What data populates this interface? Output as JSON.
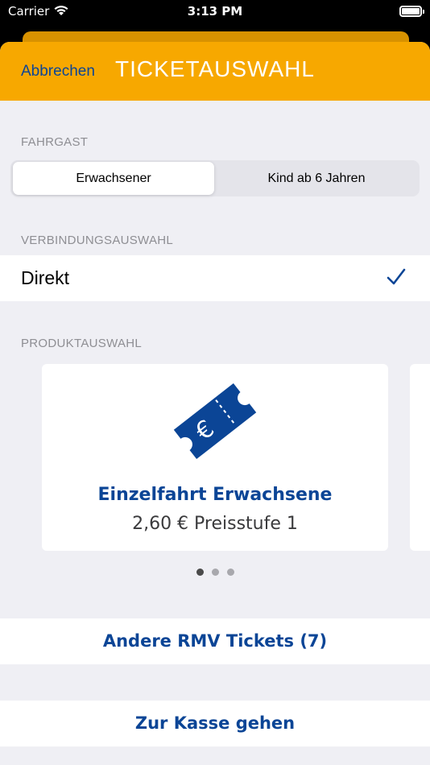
{
  "status_bar": {
    "carrier": "Carrier",
    "time": "3:13 PM"
  },
  "nav": {
    "cancel_label": "Abbrechen",
    "title": "TICKETAUSWAHL"
  },
  "fahrgast": {
    "section_label": "FAHRGAST",
    "options": [
      "Erwachsener",
      "Kind ab 6 Jahren"
    ],
    "selected": "Erwachsener"
  },
  "verbindung": {
    "section_label": "VERBINDUNGSAUSWAHL",
    "option_label": "Direkt",
    "checked": true
  },
  "produkt": {
    "section_label": "PRODUKTAUSWAHL",
    "card": {
      "icon": "ticket-euro-icon",
      "icon_symbol": "€",
      "title": "Einzelfahrt Erwachsene",
      "price": "2,60 € Preisstufe 1"
    },
    "page_count": 3,
    "current_page": 1
  },
  "actions": {
    "andere_label": "Andere RMV Tickets (7)",
    "kasse_label": "Zur Kasse gehen"
  },
  "colors": {
    "brand_yellow": "#f7a800",
    "brand_blue": "#0b4596",
    "background": "#efeff4"
  }
}
